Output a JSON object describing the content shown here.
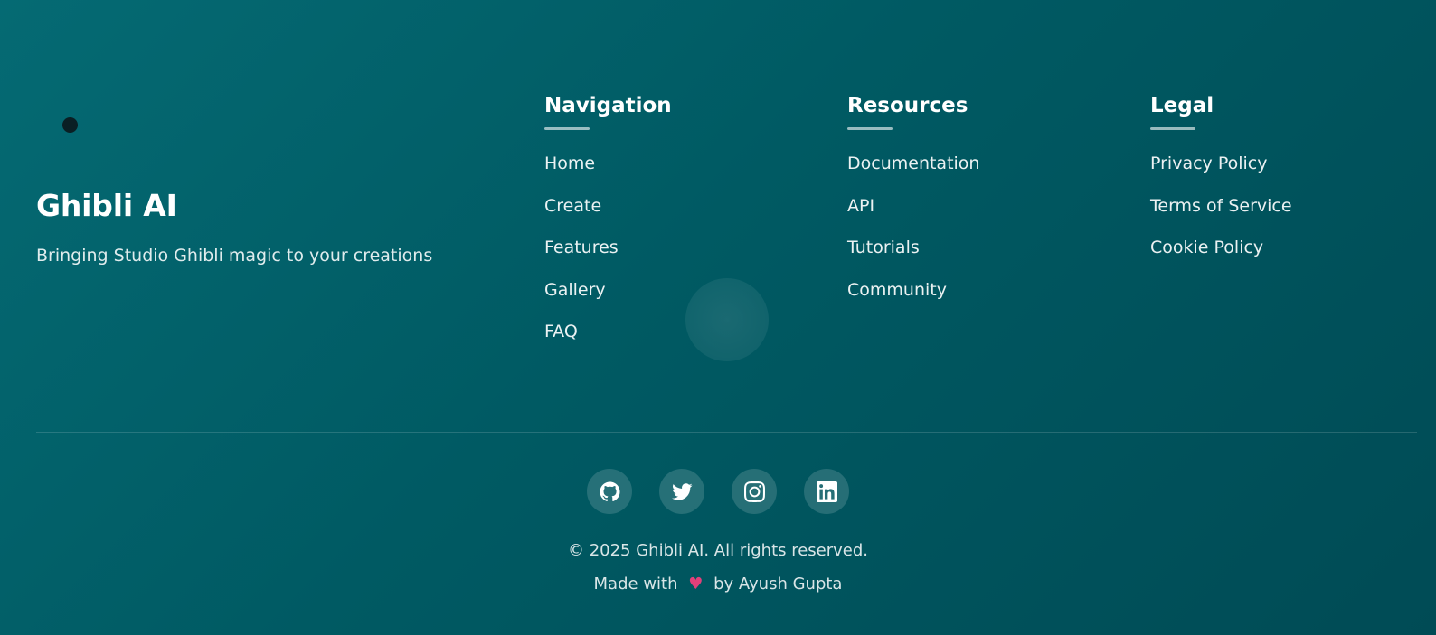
{
  "brand": {
    "title": "Ghibli AI",
    "tagline": "Bringing Studio Ghibli magic to your creations"
  },
  "columns": [
    {
      "title": "Navigation",
      "links": [
        "Home",
        "Create",
        "Features",
        "Gallery",
        "FAQ"
      ]
    },
    {
      "title": "Resources",
      "links": [
        "Documentation",
        "API",
        "Tutorials",
        "Community"
      ]
    },
    {
      "title": "Legal",
      "links": [
        "Privacy Policy",
        "Terms of Service",
        "Cookie Policy"
      ]
    }
  ],
  "social": [
    {
      "icon": "github-icon"
    },
    {
      "icon": "twitter-icon"
    },
    {
      "icon": "instagram-icon"
    },
    {
      "icon": "linkedin-icon"
    }
  ],
  "footer": {
    "copyright": "© 2025 Ghibli AI. All rights reserved.",
    "credit_prefix": "Made with",
    "credit_heart": "♥",
    "credit_suffix": "by Ayush Gupta"
  },
  "colors": {
    "background_start": "#056a73",
    "background_end": "#004b55",
    "heart": "#e2407a"
  }
}
